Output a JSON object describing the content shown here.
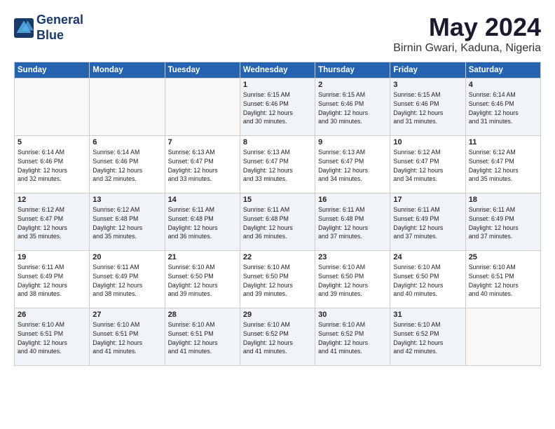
{
  "logo": {
    "line1": "General",
    "line2": "Blue"
  },
  "title": "May 2024",
  "subtitle": "Birnin Gwari, Kaduna, Nigeria",
  "weekdays": [
    "Sunday",
    "Monday",
    "Tuesday",
    "Wednesday",
    "Thursday",
    "Friday",
    "Saturday"
  ],
  "weeks": [
    [
      {
        "day": "",
        "info": ""
      },
      {
        "day": "",
        "info": ""
      },
      {
        "day": "",
        "info": ""
      },
      {
        "day": "1",
        "info": "Sunrise: 6:15 AM\nSunset: 6:46 PM\nDaylight: 12 hours\nand 30 minutes."
      },
      {
        "day": "2",
        "info": "Sunrise: 6:15 AM\nSunset: 6:46 PM\nDaylight: 12 hours\nand 30 minutes."
      },
      {
        "day": "3",
        "info": "Sunrise: 6:15 AM\nSunset: 6:46 PM\nDaylight: 12 hours\nand 31 minutes."
      },
      {
        "day": "4",
        "info": "Sunrise: 6:14 AM\nSunset: 6:46 PM\nDaylight: 12 hours\nand 31 minutes."
      }
    ],
    [
      {
        "day": "5",
        "info": "Sunrise: 6:14 AM\nSunset: 6:46 PM\nDaylight: 12 hours\nand 32 minutes."
      },
      {
        "day": "6",
        "info": "Sunrise: 6:14 AM\nSunset: 6:46 PM\nDaylight: 12 hours\nand 32 minutes."
      },
      {
        "day": "7",
        "info": "Sunrise: 6:13 AM\nSunset: 6:47 PM\nDaylight: 12 hours\nand 33 minutes."
      },
      {
        "day": "8",
        "info": "Sunrise: 6:13 AM\nSunset: 6:47 PM\nDaylight: 12 hours\nand 33 minutes."
      },
      {
        "day": "9",
        "info": "Sunrise: 6:13 AM\nSunset: 6:47 PM\nDaylight: 12 hours\nand 34 minutes."
      },
      {
        "day": "10",
        "info": "Sunrise: 6:12 AM\nSunset: 6:47 PM\nDaylight: 12 hours\nand 34 minutes."
      },
      {
        "day": "11",
        "info": "Sunrise: 6:12 AM\nSunset: 6:47 PM\nDaylight: 12 hours\nand 35 minutes."
      }
    ],
    [
      {
        "day": "12",
        "info": "Sunrise: 6:12 AM\nSunset: 6:47 PM\nDaylight: 12 hours\nand 35 minutes."
      },
      {
        "day": "13",
        "info": "Sunrise: 6:12 AM\nSunset: 6:48 PM\nDaylight: 12 hours\nand 35 minutes."
      },
      {
        "day": "14",
        "info": "Sunrise: 6:11 AM\nSunset: 6:48 PM\nDaylight: 12 hours\nand 36 minutes."
      },
      {
        "day": "15",
        "info": "Sunrise: 6:11 AM\nSunset: 6:48 PM\nDaylight: 12 hours\nand 36 minutes."
      },
      {
        "day": "16",
        "info": "Sunrise: 6:11 AM\nSunset: 6:48 PM\nDaylight: 12 hours\nand 37 minutes."
      },
      {
        "day": "17",
        "info": "Sunrise: 6:11 AM\nSunset: 6:49 PM\nDaylight: 12 hours\nand 37 minutes."
      },
      {
        "day": "18",
        "info": "Sunrise: 6:11 AM\nSunset: 6:49 PM\nDaylight: 12 hours\nand 37 minutes."
      }
    ],
    [
      {
        "day": "19",
        "info": "Sunrise: 6:11 AM\nSunset: 6:49 PM\nDaylight: 12 hours\nand 38 minutes."
      },
      {
        "day": "20",
        "info": "Sunrise: 6:11 AM\nSunset: 6:49 PM\nDaylight: 12 hours\nand 38 minutes."
      },
      {
        "day": "21",
        "info": "Sunrise: 6:10 AM\nSunset: 6:50 PM\nDaylight: 12 hours\nand 39 minutes."
      },
      {
        "day": "22",
        "info": "Sunrise: 6:10 AM\nSunset: 6:50 PM\nDaylight: 12 hours\nand 39 minutes."
      },
      {
        "day": "23",
        "info": "Sunrise: 6:10 AM\nSunset: 6:50 PM\nDaylight: 12 hours\nand 39 minutes."
      },
      {
        "day": "24",
        "info": "Sunrise: 6:10 AM\nSunset: 6:50 PM\nDaylight: 12 hours\nand 40 minutes."
      },
      {
        "day": "25",
        "info": "Sunrise: 6:10 AM\nSunset: 6:51 PM\nDaylight: 12 hours\nand 40 minutes."
      }
    ],
    [
      {
        "day": "26",
        "info": "Sunrise: 6:10 AM\nSunset: 6:51 PM\nDaylight: 12 hours\nand 40 minutes."
      },
      {
        "day": "27",
        "info": "Sunrise: 6:10 AM\nSunset: 6:51 PM\nDaylight: 12 hours\nand 41 minutes."
      },
      {
        "day": "28",
        "info": "Sunrise: 6:10 AM\nSunset: 6:51 PM\nDaylight: 12 hours\nand 41 minutes."
      },
      {
        "day": "29",
        "info": "Sunrise: 6:10 AM\nSunset: 6:52 PM\nDaylight: 12 hours\nand 41 minutes."
      },
      {
        "day": "30",
        "info": "Sunrise: 6:10 AM\nSunset: 6:52 PM\nDaylight: 12 hours\nand 41 minutes."
      },
      {
        "day": "31",
        "info": "Sunrise: 6:10 AM\nSunset: 6:52 PM\nDaylight: 12 hours\nand 42 minutes."
      },
      {
        "day": "",
        "info": ""
      }
    ]
  ]
}
